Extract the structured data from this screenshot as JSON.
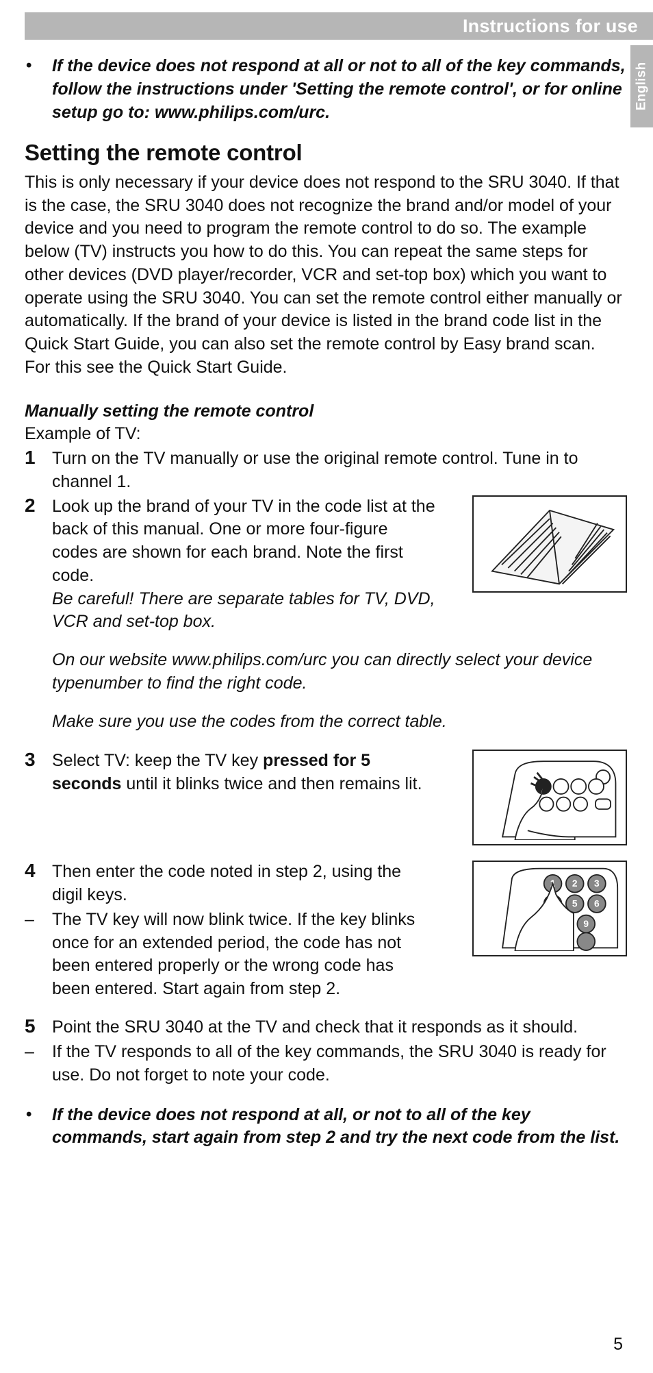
{
  "header": {
    "title": "Instructions for use"
  },
  "lang_tab": {
    "label": "English"
  },
  "top_bullet": {
    "mark": "•",
    "text": "If the device does not respond at all or not to all of the key commands, follow the instructions under 'Setting the remote control', or for online setup go to: www.philips.com/urc."
  },
  "section_title": "Setting the remote control",
  "intro": "This is only necessary if your device does not respond to the SRU 3040. If that is the case, the SRU 3040 does not recognize the brand and/or model of your device and you need to program the remote control to do so. The example below (TV) instructs you how to do this. You can repeat the same steps for other devices (DVD player/recorder, VCR and set-top box) which you want to operate using the SRU 3040. You can set the remote control either manually or automatically. If the brand of your device is listed in the brand code list in the Quick Start Guide, you can also set the remote control by Easy brand scan. For this see the Quick Start Guide.",
  "manual": {
    "subhead": "Manually setting the remote control",
    "example_line": "Example of TV:",
    "step1": {
      "num": "1",
      "text": "Turn on the TV manually or use the original remote control. Tune in to channel 1."
    },
    "step2": {
      "num": "2",
      "text_a": "Look up the brand of your TV in the code list at the back of this manual. One or more four-figure codes are shown for each brand. Note the first code.",
      "text_b_em": "Be careful! There are separate tables for TV, DVD, VCR and set-top box.",
      "text_c_em": "On our website www.philips.com/urc you can directly select your device typenumber to find the right code.",
      "text_d_em": "Make sure you use the codes from the correct table."
    },
    "step3": {
      "num": "3",
      "text_prefix": "Select TV: keep the TV key ",
      "text_bold": "pressed for 5 seconds",
      "text_suffix": " until it blinks twice and then remains lit."
    },
    "step4": {
      "num": "4",
      "text": "Then enter the code noted in step 2, using the digil keys.",
      "dash_text": "The TV key will now blink twice. If the key blinks once for an extended period, the code has not been entered properly or the wrong code has been entered. Start again from step 2."
    },
    "step5": {
      "num": "5",
      "text": "Point the SRU 3040 at the TV and check that it responds as it should.",
      "dash_text": "If the TV responds to all of the key commands, the SRU 3040 is ready for use. Do not forget to note your code."
    }
  },
  "bottom_bullet": {
    "mark": "•",
    "text": "If the device does not respond at all, or not to all of the key commands, start again from step 2 and try the next code from the list."
  },
  "page_number": "5"
}
